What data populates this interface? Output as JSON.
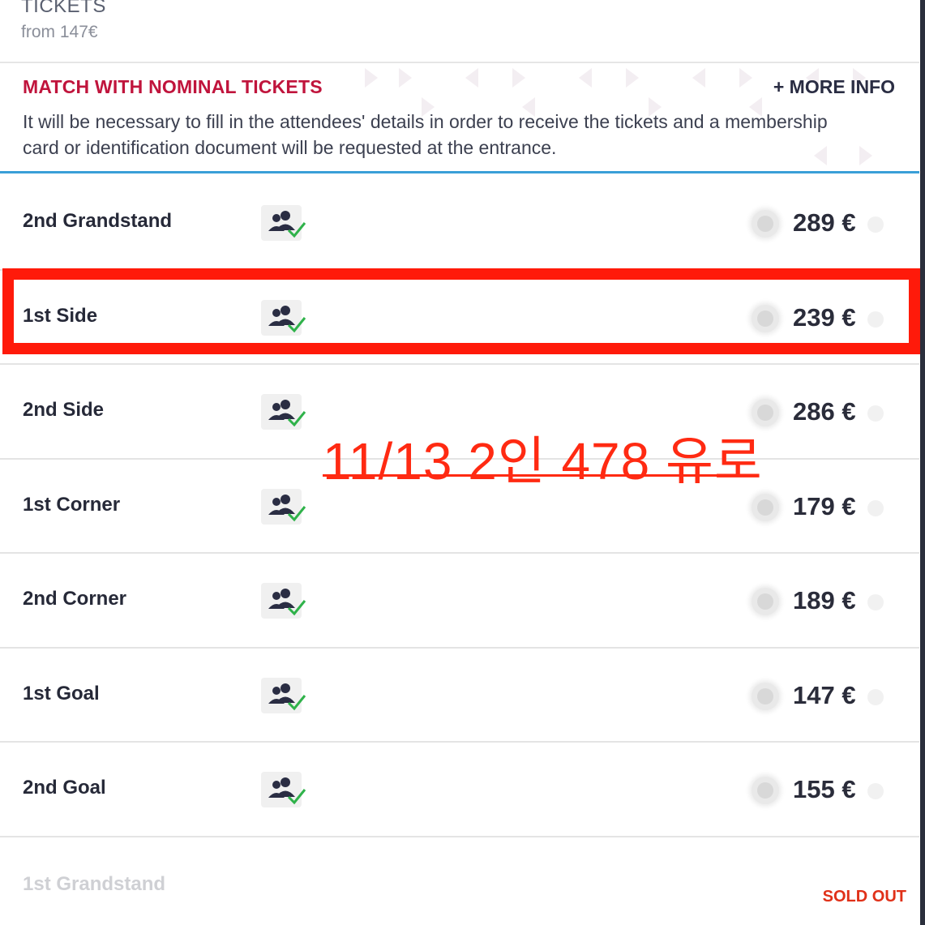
{
  "header": {
    "title": "TICKETS",
    "from_price": "from 147€"
  },
  "notice": {
    "title": "MATCH WITH NOMINAL TICKETS",
    "more_info": "+ MORE INFO",
    "text": "It will be necessary to fill in the attendees' details in order to receive the tickets and a membership card or identification document will be requested at the entrance."
  },
  "rows": [
    {
      "name": "2nd Grandstand",
      "price": "289 €",
      "selected": false
    },
    {
      "name": "1st Side",
      "price": "239 €",
      "selected": false,
      "highlighted": true
    },
    {
      "name": "2nd Side",
      "price": "286 €",
      "selected": false
    },
    {
      "name": "1st Corner",
      "price": "179 €",
      "selected": false
    },
    {
      "name": "2nd Corner",
      "price": "189 €",
      "selected": false
    },
    {
      "name": "1st Goal",
      "price": "147 €",
      "selected": false
    },
    {
      "name": "2nd Goal",
      "price": "155 €",
      "selected": false
    },
    {
      "name": "1st Grandstand",
      "status": "SOLD OUT"
    }
  ],
  "annotation": {
    "text": "11/13 2인 478 유로",
    "color": "#ff2a12"
  },
  "colors": {
    "notice_title": "#c0143c",
    "accent_line": "#3a9fd8",
    "highlight": "#ff1a0a",
    "check_green": "#2fb24a"
  },
  "icons": {
    "nominal": "nominal-ticket-people-check-icon"
  }
}
